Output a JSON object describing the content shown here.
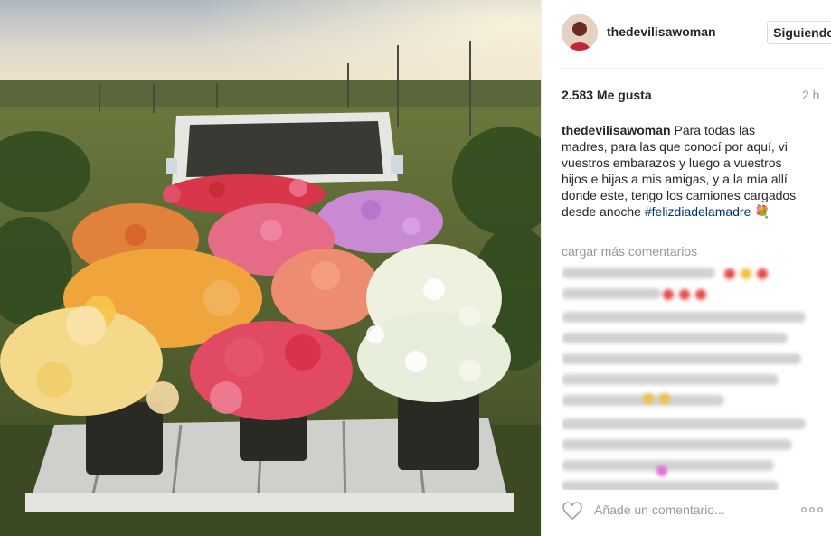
{
  "post": {
    "username": "thedevilisawoman",
    "follow_label": "Siguiendo",
    "likes": "2.583 Me gusta",
    "time": "2 h",
    "caption_user": "thedevilisawoman",
    "caption_text": "Para todas las madres, para las que conocí por aquí, vi vuestros embarazos y luego a vuestros hijos e hijas a mis amigas, y a la mía allí donde este, tengo los camiones cargados desde anoche",
    "hashtag": "#felizdiadelamadre",
    "emoji": "💐",
    "load_more": "cargar más comentarios",
    "comment_placeholder": "Añade un comentario...",
    "photo_icon": "photo-truck-of-flowers",
    "colors": {
      "hashtag": "#003569",
      "muted": "#999999",
      "border": "#efefef"
    }
  }
}
